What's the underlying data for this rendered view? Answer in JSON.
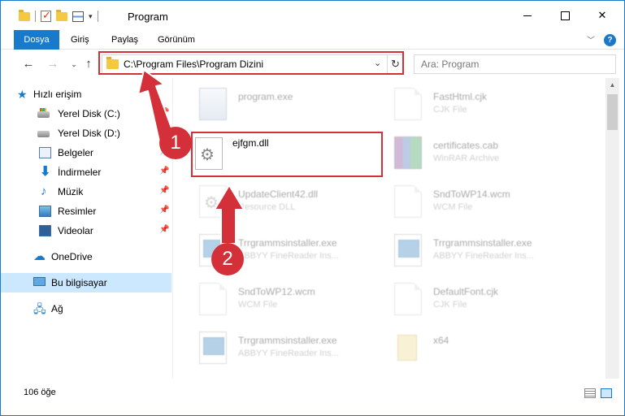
{
  "window": {
    "title": "Program",
    "colors": {
      "accent": "#1979ca",
      "annotation": "#d3303a",
      "selection": "#cce8ff"
    }
  },
  "ribbon": {
    "tabs": [
      {
        "label": "Dosya",
        "active": true
      },
      {
        "label": "Giriş"
      },
      {
        "label": "Paylaş"
      },
      {
        "label": "Görünüm"
      }
    ],
    "help_label": "?"
  },
  "navigation": {
    "address_path": "C:\\Program Files\\Program Dizini",
    "search_placeholder": "Ara: Program"
  },
  "sidebar": {
    "items": [
      {
        "label": "Hızlı erişim",
        "icon": "star-icon"
      },
      {
        "label": "Yerel Disk (C:)",
        "icon": "disk-c-icon"
      },
      {
        "label": "Yerel Disk (D:)",
        "icon": "disk-icon"
      },
      {
        "label": "Belgeler",
        "icon": "documents-icon"
      },
      {
        "label": "İndirmeler",
        "icon": "download-icon"
      },
      {
        "label": "Müzik",
        "icon": "music-icon"
      },
      {
        "label": "Resimler",
        "icon": "pictures-icon"
      },
      {
        "label": "Videolar",
        "icon": "videos-icon"
      },
      {
        "label": "OneDrive",
        "icon": "cloud-icon"
      },
      {
        "label": "Bu bilgisayar",
        "icon": "computer-icon",
        "selected": true
      },
      {
        "label": "Ağ",
        "icon": "network-icon"
      }
    ]
  },
  "files": [
    {
      "name": "program.exe",
      "type": "",
      "icon": "exe-icon"
    },
    {
      "name": "FastHtml.cjk",
      "type": "CJK File",
      "icon": "file-icon"
    },
    {
      "name": "ejfgm.dll",
      "type": "",
      "icon": "dll-gear-icon",
      "highlighted": true
    },
    {
      "name": "certificates.cab",
      "type": "WinRAR Archive",
      "icon": "archive-icon"
    },
    {
      "name": "UpdateClient42.dll",
      "type": "Resource DLL",
      "icon": "dll-gear-icon"
    },
    {
      "name": "SndToWP14.wcm",
      "type": "WCM File",
      "icon": "file-icon"
    },
    {
      "name": "Trrgrammsinstaller.exe",
      "type": "ABBYY FineReader Ins...",
      "icon": "installer-icon"
    },
    {
      "name": "Trrgrammsinstaller.exe",
      "type": "ABBYY FineReader Ins...",
      "icon": "installer-icon"
    },
    {
      "name": "SndToWP12.wcm",
      "type": "WCM File",
      "icon": "file-icon"
    },
    {
      "name": "DefaultFont.cjk",
      "type": "CJK File",
      "icon": "file-icon"
    },
    {
      "name": "Trrgrammsinstaller.exe",
      "type": "ABBYY FineReader Ins...",
      "icon": "installer-icon"
    },
    {
      "name": "x64",
      "type": "",
      "icon": "folder-icon"
    }
  ],
  "status": {
    "item_count": "106 öğe"
  },
  "annotations": {
    "step1": "1",
    "step2": "2"
  }
}
